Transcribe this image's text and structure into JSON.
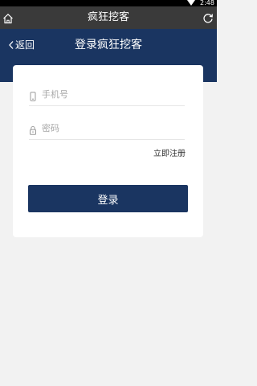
{
  "status_bar": {
    "time": "2:48"
  },
  "browser_bar": {
    "title": "疯狂挖客",
    "home_icon": "home-icon",
    "refresh_icon": "refresh-icon"
  },
  "header": {
    "back_label": "返回",
    "title": "登录疯狂挖客"
  },
  "form": {
    "phone_placeholder": "手机号",
    "phone_value": "",
    "password_placeholder": "密码",
    "password_value": "",
    "register_label": "立即注册",
    "login_label": "登录"
  },
  "colors": {
    "header_background": "#1a3561",
    "browser_bar_background": "#3a3a3a",
    "page_background": "#f2f2f2",
    "card_background": "#ffffff"
  }
}
